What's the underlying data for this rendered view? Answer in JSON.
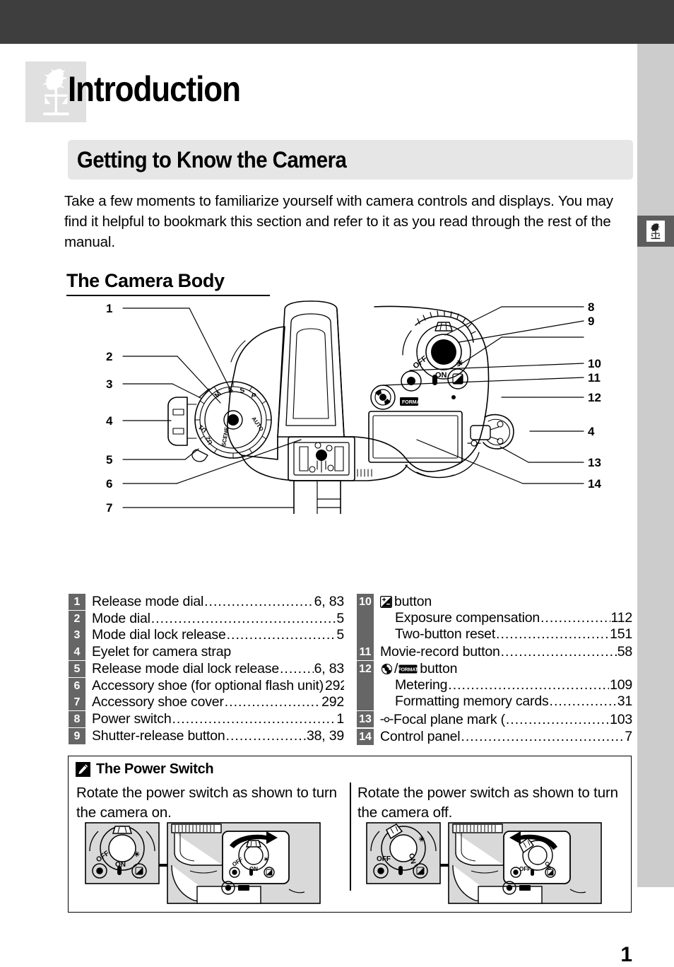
{
  "document": {
    "page_number": "1",
    "chapter_title": "Introduction",
    "chapter_icon": "rooster-weathervane-icon",
    "side_tab_icon": "rooster-weathervane-icon",
    "section_banner": "Getting to Know the Camera",
    "intro_paragraph": "Take a few moments to familiarize yourself with camera controls and displays.  You may find it helpful to bookmark this section and refer to it as you read through the rest of the manual.",
    "subheading": "The Camera Body"
  },
  "figure": {
    "name": "camera-top-view-diagram",
    "callouts": [
      "1",
      "2",
      "3",
      "4",
      "5",
      "6",
      "7",
      "8",
      "9",
      "10",
      "11",
      "12",
      "4",
      "13",
      "14"
    ],
    "dial_labels": [
      "M",
      "A",
      "S",
      "P",
      "AUTO",
      "SCENE",
      "U1",
      "U2"
    ],
    "power_switch_labels": [
      "OFF",
      "ON"
    ],
    "format_label": "FORMAT"
  },
  "index": {
    "left": [
      {
        "num": "1",
        "lines": [
          {
            "label": "Release mode dial",
            "page": "6, 83",
            "dots": true
          }
        ]
      },
      {
        "num": "2",
        "lines": [
          {
            "label": "Mode dial",
            "page": "5",
            "dots": true
          }
        ]
      },
      {
        "num": "3",
        "lines": [
          {
            "label": "Mode dial lock release",
            "page": "5",
            "dots": true
          }
        ]
      },
      {
        "num": "4",
        "lines": [
          {
            "label": "Eyelet for camera strap",
            "page": "",
            "dots": false
          }
        ]
      },
      {
        "num": "5",
        "lines": [
          {
            "label": "Release mode dial lock release",
            "page": "6, 83",
            "dots": true
          }
        ]
      },
      {
        "num": "6",
        "lines": [
          {
            "label": "Accessory shoe (for optional flash unit)",
            "page": "292",
            "dots": true
          }
        ]
      },
      {
        "num": "7",
        "lines": [
          {
            "label": "Accessory shoe cover",
            "page": "292",
            "dots": true
          }
        ]
      },
      {
        "num": "8",
        "lines": [
          {
            "label": "Power switch",
            "page": "1",
            "dots": true
          }
        ]
      },
      {
        "num": "9",
        "lines": [
          {
            "label": "Shutter-release button",
            "page": "38, 39",
            "dots": true
          }
        ]
      }
    ],
    "right": [
      {
        "num": "10",
        "icon": "exposure-compensation-icon",
        "lines": [
          {
            "label": "button",
            "page": "",
            "dots": false
          },
          {
            "label": "Exposure compensation",
            "page": "112",
            "dots": true,
            "sub": true
          },
          {
            "label": "Two-button reset",
            "page": "151",
            "dots": true,
            "sub": true
          }
        ]
      },
      {
        "num": "11",
        "lines": [
          {
            "label": "Movie-record button",
            "page": "58",
            "dots": true
          }
        ]
      },
      {
        "num": "12",
        "icon": "metering-format-icon",
        "lines": [
          {
            "label": "button",
            "page": "",
            "dots": false
          },
          {
            "label": "Metering",
            "page": "109",
            "dots": true,
            "sub": true
          },
          {
            "label": "Formatting memory cards",
            "page": "31",
            "dots": true,
            "sub": true
          }
        ]
      },
      {
        "num": "13",
        "icon": "focal-plane-mark-icon",
        "lines": [
          {
            "label": "Focal plane mark (",
            "label_after": ")",
            "page": "103",
            "dots": true
          }
        ]
      },
      {
        "num": "14",
        "lines": [
          {
            "label": "Control panel",
            "page": "7",
            "dots": true
          }
        ]
      }
    ]
  },
  "note": {
    "icon": "pencil-note-icon",
    "title": "The Power Switch",
    "column_left_text": "Rotate the power switch as shown to turn the camera on.",
    "column_right_text": "Rotate the power switch as shown to turn the camera off.",
    "figure_left_name": "power-switch-on-illustration",
    "figure_right_name": "power-switch-off-illustration",
    "switch_labels": [
      "OFF",
      "ON"
    ]
  },
  "colors": {
    "topbar": "#3e3e3e",
    "side_strip": "#cccccc",
    "side_tab": "#5d5d5d",
    "banner": "#e6e6e6",
    "badge": "#666666",
    "chapter_badge": "#e0e0e0"
  }
}
